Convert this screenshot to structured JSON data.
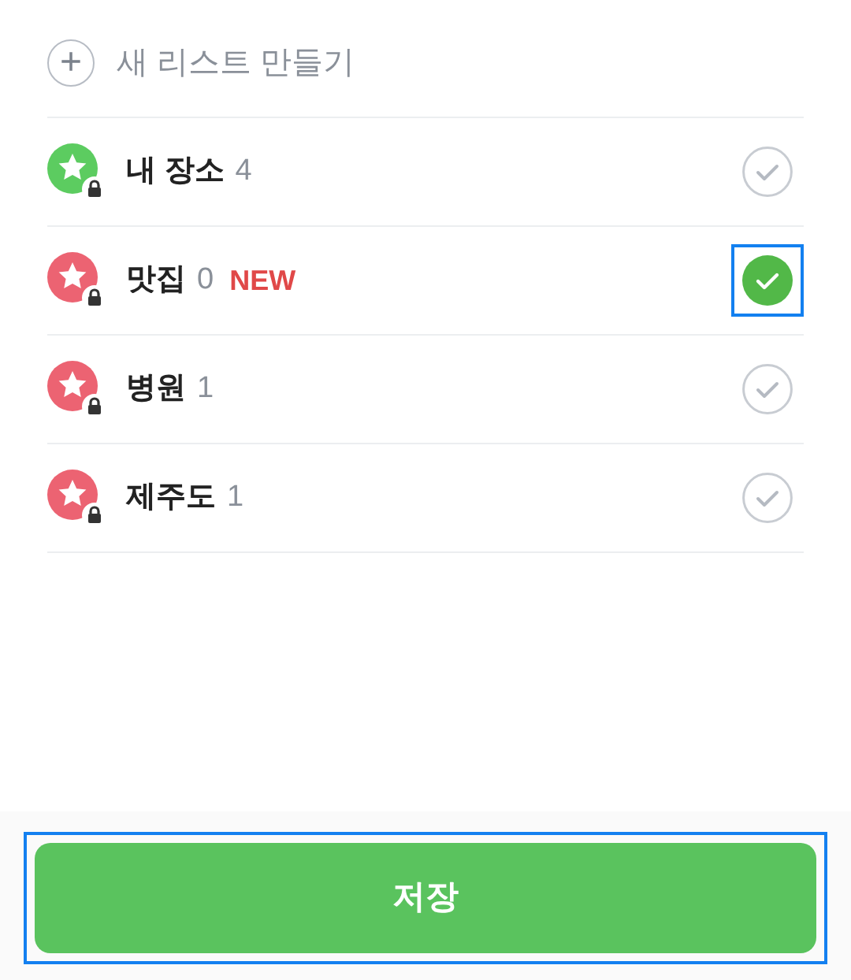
{
  "create_list": {
    "icon": "+",
    "label": "새 리스트 만들기"
  },
  "lists": [
    {
      "name": "내 장소",
      "count": "4",
      "color": "#5ccc60",
      "locked": true,
      "selected": false,
      "highlighted": false
    },
    {
      "name": "맛집",
      "count": "0",
      "badge": "NEW",
      "color": "#ec6372",
      "locked": true,
      "selected": true,
      "highlighted": true
    },
    {
      "name": "병원",
      "count": "1",
      "color": "#ec6372",
      "locked": true,
      "selected": false,
      "highlighted": false
    },
    {
      "name": "제주도",
      "count": "1",
      "color": "#ec6372",
      "locked": true,
      "selected": false,
      "highlighted": false
    }
  ],
  "save_button": {
    "label": "저장",
    "highlighted": true
  }
}
